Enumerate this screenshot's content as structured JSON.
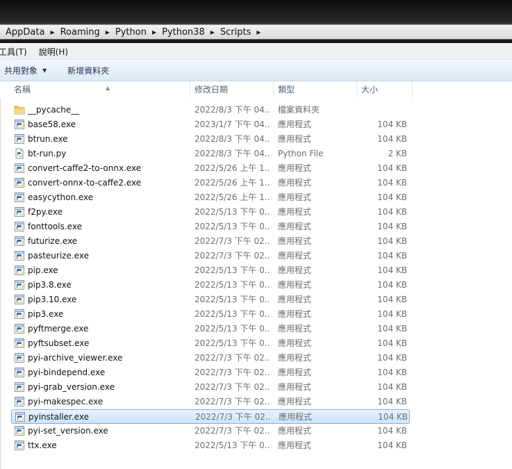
{
  "address": {
    "breadcrumbs": [
      "AppData",
      "Roaming",
      "Python",
      "Python38",
      "Scripts"
    ]
  },
  "menu": {
    "items": [
      "工具(T)",
      "說明(H)"
    ]
  },
  "toolbar": {
    "share_label": "共用對象",
    "new_folder_label": "新增資料夾"
  },
  "columns": {
    "name": "名稱",
    "date": "修改日期",
    "type": "類型",
    "size": "大小"
  },
  "files": [
    {
      "name": "__pycache__",
      "date": "2022/8/3 下午 04...",
      "type": "檔案資料夾",
      "size": "",
      "icon": "folder-icon"
    },
    {
      "name": "base58.exe",
      "date": "2023/1/7 下午 04...",
      "type": "應用程式",
      "size": "104 KB",
      "icon": "python-exe-icon"
    },
    {
      "name": "btrun.exe",
      "date": "2022/8/3 下午 04...",
      "type": "應用程式",
      "size": "104 KB",
      "icon": "python-exe-icon"
    },
    {
      "name": "bt-run.py",
      "date": "2022/8/3 下午 04...",
      "type": "Python File",
      "size": "2 KB",
      "icon": "python-file-icon"
    },
    {
      "name": "convert-caffe2-to-onnx.exe",
      "date": "2022/5/26 上午 1...",
      "type": "應用程式",
      "size": "104 KB",
      "icon": "python-exe-icon"
    },
    {
      "name": "convert-onnx-to-caffe2.exe",
      "date": "2022/5/26 上午 1...",
      "type": "應用程式",
      "size": "104 KB",
      "icon": "python-exe-icon"
    },
    {
      "name": "easycython.exe",
      "date": "2022/5/26 上午 1...",
      "type": "應用程式",
      "size": "104 KB",
      "icon": "python-exe-icon"
    },
    {
      "name": "f2py.exe",
      "date": "2022/5/13 下午 0...",
      "type": "應用程式",
      "size": "104 KB",
      "icon": "python-exe-icon"
    },
    {
      "name": "fonttools.exe",
      "date": "2022/5/13 下午 0...",
      "type": "應用程式",
      "size": "104 KB",
      "icon": "python-exe-icon"
    },
    {
      "name": "futurize.exe",
      "date": "2022/7/3 下午 02...",
      "type": "應用程式",
      "size": "104 KB",
      "icon": "python-exe-icon"
    },
    {
      "name": "pasteurize.exe",
      "date": "2022/7/3 下午 02...",
      "type": "應用程式",
      "size": "104 KB",
      "icon": "python-exe-icon"
    },
    {
      "name": "pip.exe",
      "date": "2022/5/13 下午 0...",
      "type": "應用程式",
      "size": "104 KB",
      "icon": "python-exe-icon"
    },
    {
      "name": "pip3.8.exe",
      "date": "2022/5/13 下午 0...",
      "type": "應用程式",
      "size": "104 KB",
      "icon": "python-exe-icon"
    },
    {
      "name": "pip3.10.exe",
      "date": "2022/5/13 下午 0...",
      "type": "應用程式",
      "size": "104 KB",
      "icon": "python-exe-icon"
    },
    {
      "name": "pip3.exe",
      "date": "2022/5/13 下午 0...",
      "type": "應用程式",
      "size": "104 KB",
      "icon": "python-exe-icon"
    },
    {
      "name": "pyftmerge.exe",
      "date": "2022/5/13 下午 0...",
      "type": "應用程式",
      "size": "104 KB",
      "icon": "python-exe-icon"
    },
    {
      "name": "pyftsubset.exe",
      "date": "2022/5/13 下午 0...",
      "type": "應用程式",
      "size": "104 KB",
      "icon": "python-exe-icon"
    },
    {
      "name": "pyi-archive_viewer.exe",
      "date": "2022/7/3 下午 02...",
      "type": "應用程式",
      "size": "104 KB",
      "icon": "python-exe-icon"
    },
    {
      "name": "pyi-bindepend.exe",
      "date": "2022/7/3 下午 02...",
      "type": "應用程式",
      "size": "104 KB",
      "icon": "python-exe-icon"
    },
    {
      "name": "pyi-grab_version.exe",
      "date": "2022/7/3 下午 02...",
      "type": "應用程式",
      "size": "104 KB",
      "icon": "python-exe-icon"
    },
    {
      "name": "pyi-makespec.exe",
      "date": "2022/7/3 下午 02...",
      "type": "應用程式",
      "size": "104 KB",
      "icon": "python-exe-icon"
    },
    {
      "name": "pyinstaller.exe",
      "date": "2022/7/3 下午 02...",
      "type": "應用程式",
      "size": "104 KB",
      "icon": "python-exe-icon",
      "selected": true
    },
    {
      "name": "pyi-set_version.exe",
      "date": "2022/7/3 下午 02...",
      "type": "應用程式",
      "size": "104 KB",
      "icon": "python-exe-icon"
    },
    {
      "name": "ttx.exe",
      "date": "2022/5/13 下午 0...",
      "type": "應用程式",
      "size": "104 KB",
      "icon": "python-exe-icon"
    }
  ],
  "colors": {
    "selection_border": "#84acdd",
    "selection_fill": "#cde4fa",
    "header_text": "#4c607a",
    "folder": "#e8c25a"
  }
}
